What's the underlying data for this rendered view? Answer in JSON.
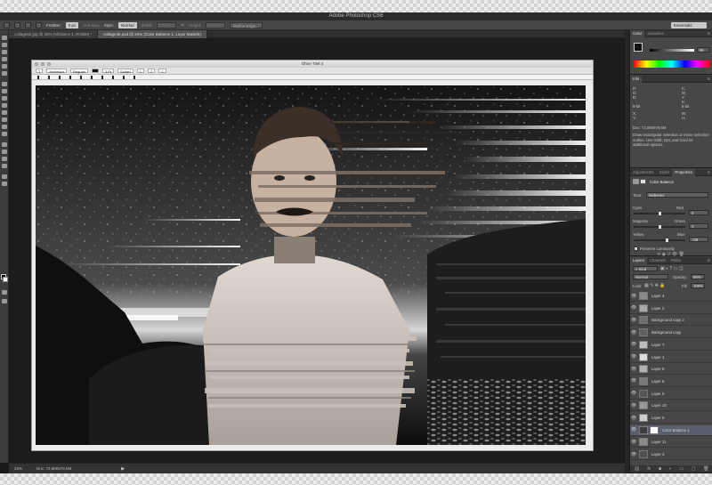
{
  "app": {
    "title": "Adobe Photoshop CS6",
    "workspace": "Essentials"
  },
  "options_bar": {
    "feather_label": "Feather:",
    "feather_value": "0 px",
    "anti_alias_label": "Anti-alias",
    "style_label": "Style:",
    "style_value": "Normal",
    "width_label": "Width:",
    "height_label": "Height:",
    "refine_edge_label": "Refine Edge..."
  },
  "document_tabs": [
    {
      "label": "collage4b.jpg @ 25% (Vibrance 1, RGB/8) *",
      "active": false
    },
    {
      "label": "collage4b.psd @ 25% (Color Balance 1, Layer Mask/8)",
      "active": true
    }
  ],
  "document_window": {
    "title": "Ohne Titel 4",
    "font_label": "Helvetica",
    "style_label": "Regular",
    "size_label": "3 Pt",
    "aa_label": "Scharf"
  },
  "status_bar": {
    "zoom": "25%",
    "doc_info": "Doc: 72,8M/679,6M"
  },
  "color_panel": {
    "tabs": [
      "Color",
      "Swatches"
    ],
    "value": "96",
    "fg_color": "#111111",
    "bg_color": "#ffffff"
  },
  "info_panel": {
    "tab": "Info",
    "r": "R:",
    "g": "G:",
    "b": "B:",
    "c": "C:",
    "m": "M:",
    "y": "Y:",
    "k": "K:",
    "bit_left": "8-bit",
    "bit_right": "8-bit",
    "x": "X:",
    "y_coord": "Y:",
    "w": "W:",
    "h": "H:",
    "doc_info": "Doc: 72,8M/679,6M",
    "hint": "Draw rectangular selection or move selection outline. Use Shift, Opt, and Cmd for additional options."
  },
  "properties_panel": {
    "tabs": [
      "Adjustments",
      "Styles",
      "Properties"
    ],
    "title": "Color Balance",
    "tone_label": "Tone:",
    "tone_value": "Midtones",
    "sliders": [
      {
        "left": "Cyan",
        "right": "Red",
        "value": "0",
        "fraction": 0.5
      },
      {
        "left": "Magenta",
        "right": "Green",
        "value": "0",
        "fraction": 0.5
      },
      {
        "left": "Yellow",
        "right": "Blue",
        "value": "+29",
        "fraction": 0.645
      }
    ],
    "preserve_label": "Preserve Luminosity",
    "preserve_checked": true
  },
  "layers_panel": {
    "tabs": [
      "Layers",
      "Channels",
      "Paths"
    ],
    "filter_label": "Kind",
    "blend_mode": "Normal",
    "opacity_label": "Opacity:",
    "opacity_value": "86%",
    "lock_label": "Lock:",
    "fill_label": "Fill:",
    "fill_value": "100%",
    "layers": [
      {
        "name": "Layer 4",
        "thumb": "#8a8a8a",
        "mask": false,
        "selected": false
      },
      {
        "name": "Layer 2",
        "thumb": "#a9a9a9",
        "mask": false,
        "selected": false
      },
      {
        "name": "Background copy 2",
        "thumb": "#6e6e6e",
        "mask": false,
        "selected": false
      },
      {
        "name": "Background copy",
        "thumb": "#5f5f5f",
        "mask": false,
        "selected": false
      },
      {
        "name": "Layer 7",
        "thumb": "#bdbdbd",
        "mask": false,
        "selected": false
      },
      {
        "name": "Layer 1",
        "thumb": "#dcdcdc",
        "mask": false,
        "selected": false
      },
      {
        "name": "Layer 8",
        "thumb": "#b1b1b1",
        "mask": false,
        "selected": false
      },
      {
        "name": "Layer 6",
        "thumb": "#777777",
        "mask": false,
        "selected": false
      },
      {
        "name": "Layer 9",
        "thumb": "#555555",
        "mask": false,
        "selected": false
      },
      {
        "name": "Layer 10",
        "thumb": "#999999",
        "mask": false,
        "selected": false
      },
      {
        "name": "Layer 5",
        "thumb": "#cfcfcf",
        "mask": false,
        "selected": false
      },
      {
        "name": "Color Balance 1",
        "thumb": "#3c3c3c",
        "mask": true,
        "selected": true
      },
      {
        "name": "Layer 11",
        "thumb": "#8c8c8c",
        "mask": false,
        "selected": false
      },
      {
        "name": "Layer 3",
        "thumb": "#4e4e4e",
        "mask": false,
        "selected": false
      }
    ]
  }
}
